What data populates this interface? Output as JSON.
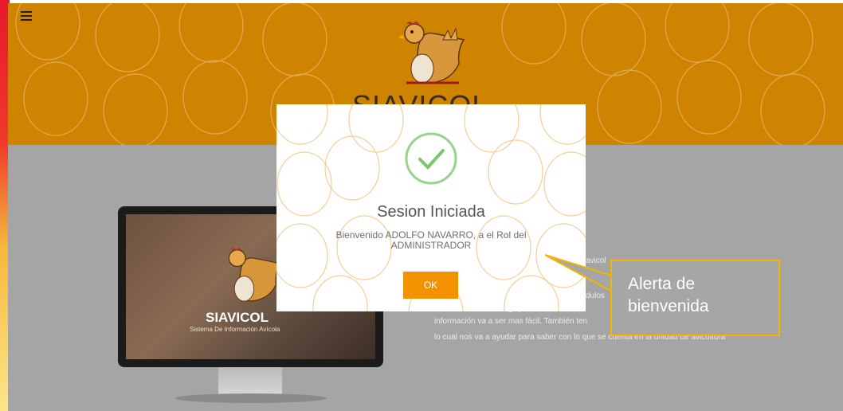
{
  "header": {
    "brand_title": "SIAVICOL",
    "menu_icon": "hamburger-menu-icon",
    "logo_icon": "hen-with-egg-logo",
    "background_color": "#cf8400"
  },
  "monitor": {
    "screen_brand": "SIAVICOL",
    "screen_subtitle": "Sistema De Información Avícola"
  },
  "paragraph": {
    "lines": [
      "avicol",
      "dulos",
      "información de cada galpón lo cual es mu",
      "información va a ser mas fácil. También ten",
      "lo cual nos va a ayudar para saber con lo que se cuenta en la unidad de avicultura"
    ]
  },
  "modal": {
    "icon": "success-check-icon",
    "title": "Sesion Iniciada",
    "message": "Bienvenido ADOLFO NAVARRO, a el Rol del ADMINISTRADOR",
    "ok_label": "OK",
    "button_color": "#f29200",
    "check_color": "#8ccf7e"
  },
  "callout": {
    "text_line1": "Alerta de",
    "text_line2": "bienvenida",
    "border_color": "#f4b400"
  }
}
